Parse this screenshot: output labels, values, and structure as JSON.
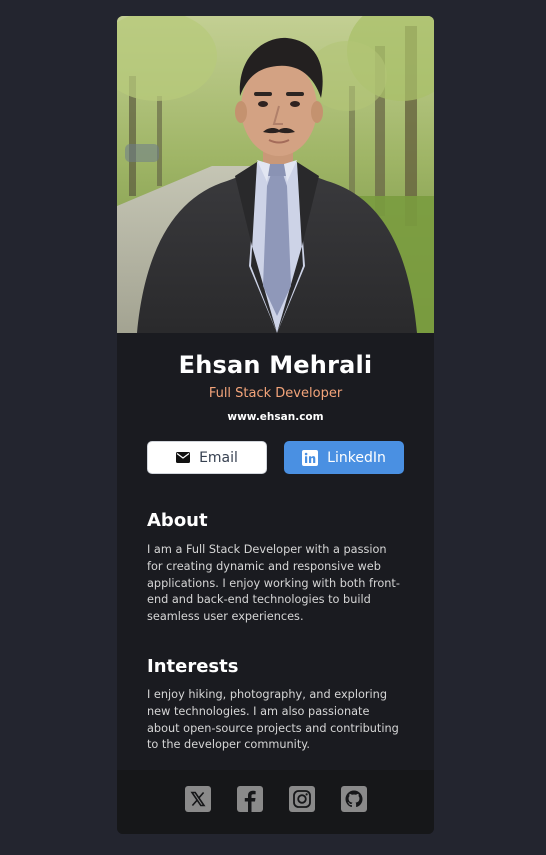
{
  "profile": {
    "name": "Ehsan Mehrali",
    "role": "Full Stack Developer",
    "website": "www.ehsan.com"
  },
  "buttons": {
    "email_label": "Email",
    "email_icon": "envelope-icon",
    "linkedin_label": "LinkedIn",
    "linkedin_icon": "linkedin-icon"
  },
  "about": {
    "title": "About",
    "text": "I am a Full Stack Developer with a passion for creating dynamic and responsive web applications. I enjoy working with both front-end and back-end technologies to build seamless user experiences."
  },
  "interests": {
    "title": "Interests",
    "text": "I enjoy hiking, photography, and exploring new technologies. I am also passionate about open-source projects and contributing to the developer community."
  },
  "social": [
    "x-icon",
    "facebook-icon",
    "instagram-icon",
    "github-icon"
  ],
  "colors": {
    "page_background": "#23252f",
    "card_background": "#1a1b20",
    "footer_background": "#161719",
    "role_accent": "#f3a47a",
    "linkedin_blue": "#4a90e2",
    "social_icon_gray": "#8a8a8a"
  }
}
